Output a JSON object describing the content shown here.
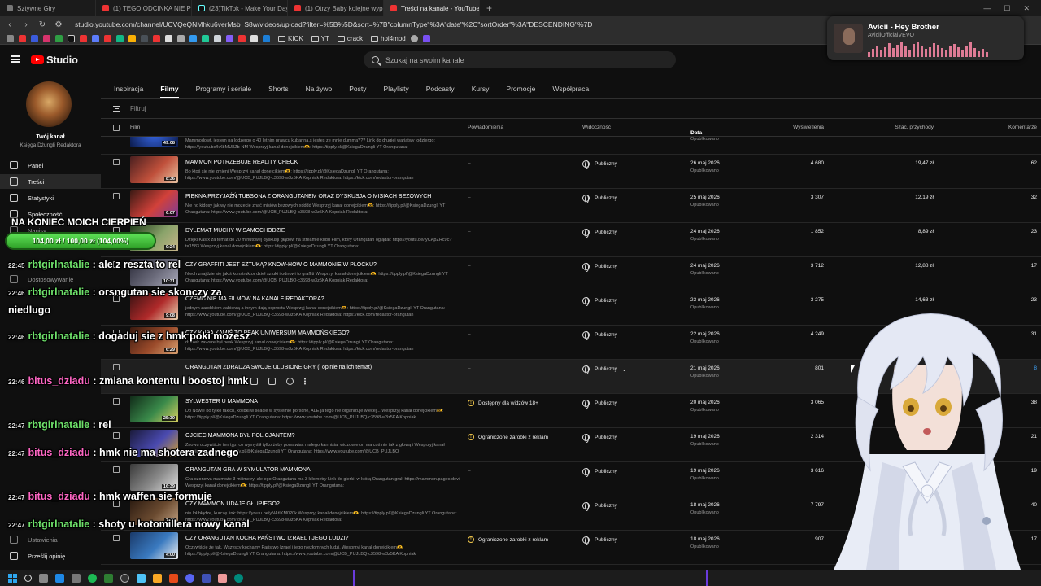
{
  "browser": {
    "tabs": [
      {
        "label": "Sztywne Giry",
        "active": false
      },
      {
        "label": "(1) TEGO ODCINKA NIE POWINNO",
        "active": false
      },
      {
        "label": "(23)TikTok - Make Your Day",
        "active": false
      },
      {
        "label": "(1) Otrzy Baby kolejne wypadki samo",
        "active": false
      },
      {
        "label": "Treści na kanale - YouTube Studio",
        "active": true
      }
    ],
    "url": "studio.youtube.com/channel/UCVQeQNMhku6verMsb_S8w/videos/upload?filter=%5B%5D&sort=%7B\"columnType\"%3A\"date\"%2C\"sortOrder\"%3A\"DESCENDING\"%7D",
    "bookmark_folders": [
      "KICK",
      "YT",
      "crack",
      "hoi4mod"
    ]
  },
  "media": {
    "title": "Avicii - Hey Brother",
    "artist": "AviciiOfficialVEVO"
  },
  "studio": {
    "logo_text": "Studio",
    "search_placeholder": "Szukaj na swoim kanale"
  },
  "sidebar": {
    "channel_label": "Twój kanał",
    "channel_name": "Księga Dżungli Redaktora",
    "items": [
      {
        "label": "Panel",
        "active": false
      },
      {
        "label": "Treści",
        "active": true
      },
      {
        "label": "Statystyki",
        "active": false
      },
      {
        "label": "Społeczność",
        "active": false
      },
      {
        "label": "Napisy",
        "active": false
      },
      {
        "label": "Dostosowywanie",
        "active": false
      },
      {
        "label": "Ustawienia",
        "active": false
      },
      {
        "label": "Prześlij opinię",
        "active": false
      }
    ]
  },
  "content_tabs": [
    "Inspiracja",
    "Filmy",
    "Programy i seriale",
    "Shorts",
    "Na żywo",
    "Posty",
    "Playlisty",
    "Podcasty",
    "Kursy",
    "Promocje",
    "Współpraca"
  ],
  "active_tab": "Filmy",
  "filter_placeholder": "Filtruj",
  "table": {
    "headers": {
      "film": "Film",
      "restrictions": "Powiadomienia",
      "visibility": "Widoczność",
      "date": "Data",
      "views": "Wyświetlenia",
      "revenue": "Szac. przychody",
      "comments": "Komentarze"
    },
    "top_partial": {
      "duration": "49:08",
      "desc": "Mammodowt, jestem na lodzergo o 40 letnim prawcu kubanna,s jestes ze mnie dumma??? Link do drugiej wariatwy lodziergo: https://youtu.be/kXbMU8Zb-NM Wesprzyj kanał donejcikiem🫶: https://tipply.pl/@KsiegaDzungli YT Orangutana:",
      "date_sub": "Opublikowano"
    },
    "rows": [
      {
        "title": "MAMMON POTRZEBUJE REALITY CHECK",
        "desc": "Bo ktoś się nie zmieni Wesprzyj kanał donejcikiem🫶: https://tipply.pl/@KsiegaDzungli YT Orangutana: https://www.youtube.com/@UCB_PUJLBQ-c3598-w3z5KA Kopniak Redaktora: https://kick.com/redaktor-orangutan",
        "duration": "8:36",
        "restriction": "–",
        "restriction_warn": false,
        "visibility": "Publiczny",
        "date": "26 maj 2026",
        "date_sub": "Opublikowano",
        "views": "4 680",
        "revenue": "19,47 zł",
        "comments": "62",
        "thumb": [
          "#4a1f1f",
          "#c0503b",
          "#e8c3a2"
        ]
      },
      {
        "title": "PIĘKNA PRZYJAŹŃ TUBSONA Z ORANGUTANEM ORAZ DYSKUSJA O MISIACH BEZOWYCH",
        "desc": "Nie no kidosy jak wy nie możecie znać misiów bezowych xdddd Wesprzyj kanał donejcikiem🫶: https://tipply.pl/@KsiegaDzungli YT Orangutana: https://www.youtube.com/@UCB_PUJLBQ-c3598-w3z5KA Kopniak Redaktora:",
        "duration": "6:07",
        "restriction": "–",
        "restriction_warn": false,
        "visibility": "Publiczny",
        "date": "25 maj 2026",
        "date_sub": "Opublikowano",
        "views": "3 307",
        "revenue": "12,19 zł",
        "comments": "32",
        "thumb": [
          "#3b1a14",
          "#d2413a",
          "#7b3c9a"
        ]
      },
      {
        "title": "DYLEMAT MUCHY W SAMOCHODZIE",
        "desc": "Dzięki Kasix za temat do 20 minutowej dyskusji głąbów na streamie kddd Film, który Orangutan oglądał: https://youtu.be/lyCApZRc9c?t=1583 Wesprzyj kanał donejcikiem🫶: https://tipply.pl/@KsiegaDzungli YT Orangutana:",
        "duration": "9:24",
        "restriction": "–",
        "restriction_warn": false,
        "visibility": "Publiczny",
        "date": "24 maj 2026",
        "date_sub": "Opublikowano",
        "views": "1 852",
        "revenue": "8,89 zł",
        "comments": "23",
        "thumb": [
          "#1e3a1a",
          "#8aa36a",
          "#c9b58a"
        ]
      },
      {
        "title": "CZY GRAFFITI JEST SZTUKĄ? KNOW-HOW O MAMMONIE W PŁOCKU?",
        "desc": "Niech znajdzie się jakiś konstruktor dzieł sztuki i odnowi to graffiti Wesprzyj kanał donejcikiem🫶: https://tipply.pl/@KsiegaDzungli YT Orangutana: https://www.youtube.com/@UCB_PUJLBQ-c3598-w3z5KA Kopniak Redaktora:",
        "duration": "10:31",
        "restriction": "–",
        "restriction_warn": false,
        "visibility": "Publiczny",
        "date": "24 maj 2026",
        "date_sub": "Opublikowano",
        "views": "3 712",
        "revenue": "12,88 zł",
        "comments": "17",
        "thumb": [
          "#2a2a38",
          "#6a6a7a",
          "#a8a8b8"
        ]
      },
      {
        "title": "CZEMU NIE MA FILMÓW NA KANALE REDAKTORA?",
        "desc": "jednym zarobkiem zabierzą a innym dają poprostu Wesprzyj kanał donejcikiem🫶: https://tipply.pl/@KsiegaDzungli YT Orangutana: https://www.youtube.com/@UCB_PUJLBQ-c3598-w3z5KA Kopniak Redaktora: https://kick.com/redaktor-orangutan",
        "duration": "9:08",
        "restriction": "–",
        "restriction_warn": false,
        "visibility": "Publiczny",
        "date": "23 maj 2026",
        "date_sub": "Opublikowano",
        "views": "3 275",
        "revenue": "14,63 zł",
        "comments": "23",
        "thumb": [
          "#3a1212",
          "#b02a2a",
          "#e8d2b0"
        ]
      },
      {
        "title": "CZY KUBA KAMIŚ TO PEAK UNIWERSUM MAMMOŃSKIEGO?",
        "desc": "działek zawsze był peak Wesprzyj kanał donejcikiem🫶: https://tipply.pl/@KsiegaDzungli YT Orangutana: https://www.youtube.com/@UCB_PUJLBQ-c3598-w3z5KA Kopniak Redaktora: https://kick.com/redaktor-orangutan",
        "duration": "6:29",
        "restriction": "–",
        "restriction_warn": false,
        "visibility": "Publiczny",
        "date": "22 maj 2026",
        "date_sub": "Opublikowano",
        "views": "4 249",
        "revenue": "",
        "comments": "31",
        "thumb": [
          "#3a1a10",
          "#9a4a2a",
          "#d8a070"
        ]
      },
      {
        "title": "ORANGUTAN ZDRADZA SWOJE ULUBIONE GRY (i opinie na ich temat)",
        "desc": "",
        "duration": "",
        "restriction": "–",
        "restriction_warn": false,
        "visibility": "Publiczny",
        "date": "21 maj 2026",
        "date_sub": "Opublikowano",
        "views": "801",
        "revenue": "",
        "comments": "8",
        "hover": true,
        "thumb": [
          "#1f1f1f",
          "#1f1f1f",
          "#1f1f1f"
        ]
      },
      {
        "title": "SYLWESTER U MAMMONA",
        "desc": "Do Nowie bo tylko takich, kolibki w seacie w systemie porsche, ALE ja tego nie organizuje wiecej... Wesprzyj kanał donejcikiem🫶: https://tipply.pl/@KsiegaDzungli YT Orangutana: https://www.youtube.com/@UCB_PUJLBQ-c3598-w3z5KA Kopniak",
        "duration": "25:30",
        "restriction": "Dostępny dla widzów 18+",
        "restriction_warn": true,
        "visibility": "Publiczny",
        "date": "20 maj 2026",
        "date_sub": "Opublikowano",
        "views": "3 065",
        "revenue": "",
        "comments": "38",
        "thumb": [
          "#102a18",
          "#3a8a4a",
          "#d8d060"
        ]
      },
      {
        "title": "OJCIEC MAMMONA BYŁ POLICJANTEM?",
        "desc": "Znowu oczywiście ten typ, co wymyślił tylko żeby pomawiać małego karmisia, widzowie on ma coś nie tak z głową i Wesprzyj kanał donejcikiem🫶: https://tipply.pl/@KsiegaDzungli YT Orangutana: https://www.youtube.com/@UCB_PUJLBQ",
        "duration": "13:22",
        "restriction": "Ograniczone zarobki z reklam",
        "restriction_warn": true,
        "visibility": "Publiczny",
        "date": "19 maj 2026",
        "date_sub": "Opublikowano",
        "views": "2 314",
        "revenue": "",
        "comments": "21",
        "thumb": [
          "#1a1a3a",
          "#4a4ab0",
          "#d0a030"
        ]
      },
      {
        "title": "ORANGUTAN GRA W SYMULATOR MAMMONA",
        "desc": "Gra ozonowa ma może 3 milimetry, ale ego Orangutana ma 3 kilometry Link do gierki, w którą Orangutan grał: https://mammon.pages.dev/ Wesprzyj kanał donejcikiem🫶: https://tipply.pl/@KsiegaDzungli YT Orangutana:",
        "duration": "16:39",
        "restriction": "–",
        "restriction_warn": false,
        "visibility": "Publiczny",
        "date": "19 maj 2026",
        "date_sub": "Opublikowano",
        "views": "3 616",
        "revenue": "",
        "comments": "19",
        "thumb": [
          "#3a3a3a",
          "#8a8a8a",
          "#e0e0e0"
        ]
      },
      {
        "title": "CZY MAMMON UDAJE GŁUPIEGO?",
        "desc": "nie loł błądze, kurczę link: https://youtu.be/yNAtIKM020k Wesprzyj kanał donejcikiem🫶: https://tipply.pl/@KsiegaDzungli YT Orangutana: https://www.youtube.com/@UCB_PUJLBQ-c3598-w3z5KA Kopniak Redaktora:",
        "duration": "7:18",
        "restriction": "–",
        "restriction_warn": false,
        "visibility": "Publiczny",
        "date": "18 maj 2026",
        "date_sub": "Opublikowano",
        "views": "7 797",
        "revenue": "",
        "comments": "40",
        "thumb": [
          "#2a1a10",
          "#6a4a30",
          "#c0a080"
        ]
      },
      {
        "title": "CZY ORANGUTAN KOCHA PAŃSTWO IZRAEL I JEGO LUDZI?",
        "desc": "Oczywiście że tak. Wszyscy kochamy Państwo Izrael i jego niezłomnych ludzi. Wesprzyj kanał donejcikiem🫶: https://tipply.pl/@KsiegaDzungli YT Orangutana: https://www.youtube.com/@UCB_PUJLBQ-c3598-w3z5KA Kopniak",
        "duration": "4:00",
        "restriction": "Ograniczone zarobki z reklam",
        "restriction_warn": true,
        "visibility": "Publiczny",
        "date": "18 maj 2026",
        "date_sub": "Opublikowano",
        "views": "907",
        "revenue": "",
        "comments": "17",
        "thumb": [
          "#1a3a6a",
          "#3a7ac0",
          "#f0f0f0"
        ]
      }
    ]
  },
  "stream_overlay": {
    "goal_title": "NA KONIEC MOICH CIERPIEŃ",
    "goal_text": "104,00 zł / 100,00 zł (104,00%)",
    "goal_progress": 1.04,
    "chat": [
      {
        "ts": "22:45",
        "user": "rbtgirlnatalie",
        "color": "green",
        "text": ": ale z reszta to rel"
      },
      {
        "ts": "22:46",
        "user": "rbtgirlnatalie",
        "color": "green",
        "text": ": orsngutan sie skonczy za niedlugo"
      },
      {
        "ts": "22:46",
        "user": "rbtgirlnatalie",
        "color": "green",
        "text": ": dogaduj sie z hmk poki mozesz"
      },
      {
        "ts": "22:46",
        "user": "bitus_dziadu",
        "color": "pink",
        "text": ": zmiana kontentu i boostoj hmk"
      },
      {
        "ts": "22:47",
        "user": "rbtgirlnatalie",
        "color": "green",
        "text": ": rel"
      },
      {
        "ts": "22:47",
        "user": "bitus_dziadu",
        "color": "pink",
        "text": ": hmk nie ma shotera zadnego"
      },
      {
        "ts": "22:47",
        "user": "bitus_dziadu",
        "color": "pink",
        "text": ": hmk waffen sie formuje"
      },
      {
        "ts": "22:47",
        "user": "rbtgirlnatalie",
        "color": "green",
        "text": ": shoty u kotomillera nowy kanal"
      }
    ]
  },
  "colors": {
    "accent_red": "#ff0000",
    "chat_green": "#6fe36b",
    "chat_pink": "#ff66c4",
    "warning": "#f2c84b",
    "goal_green": "#5ee157"
  }
}
